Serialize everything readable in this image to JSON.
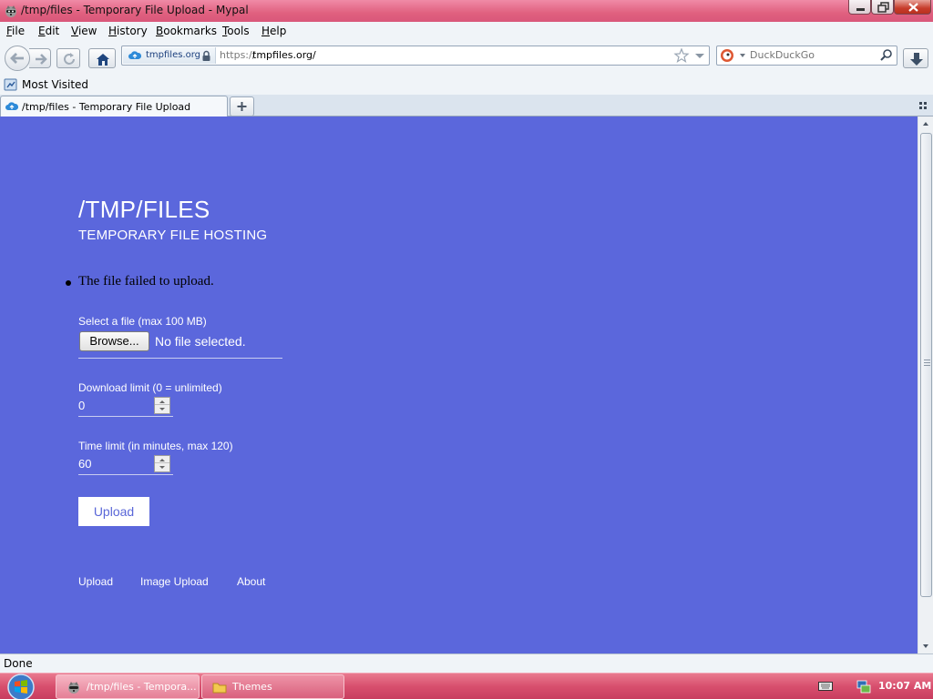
{
  "window": {
    "title": "/tmp/files - Temporary File Upload - Mypal"
  },
  "menu": {
    "items": [
      {
        "label": "File",
        "mnemonic": "F",
        "rest": "ile"
      },
      {
        "label": "Edit",
        "mnemonic": "E",
        "rest": "dit"
      },
      {
        "label": "View",
        "mnemonic": "V",
        "rest": "iew"
      },
      {
        "label": "History",
        "mnemonic": "H",
        "rest": "istory"
      },
      {
        "label": "Bookmarks",
        "mnemonic": "B",
        "rest": "ookmarks"
      },
      {
        "label": "Tools",
        "mnemonic": "T",
        "rest": "ools"
      },
      {
        "label": "Help",
        "mnemonic": "H",
        "rest": "elp"
      }
    ]
  },
  "navbar": {
    "identity_label": "tmpfiles.org",
    "url_protocol": "https://",
    "url_host": "tmpfiles.org/",
    "search_placeholder": "DuckDuckGo"
  },
  "bookmarks": {
    "most_visited": "Most Visited"
  },
  "tabs": [
    {
      "label": "/tmp/files - Temporary File Upload",
      "active": true
    }
  ],
  "page": {
    "background": "#5b67dc",
    "title": "/TMP/FILES",
    "subtitle": "TEMPORARY FILE HOSTING",
    "error_message": "The file failed to upload.",
    "file_field": {
      "label": "Select a file (max 100 MB)",
      "button_label": "Browse...",
      "status": "No file selected."
    },
    "download_limit": {
      "label": "Download limit (0 = unlimited)",
      "value": "0"
    },
    "time_limit": {
      "label": "Time limit (in minutes, max 120)",
      "value": "60"
    },
    "upload_button": "Upload",
    "footer_links": [
      "Upload",
      "Image Upload",
      "About"
    ]
  },
  "status_bar": {
    "text": "Done"
  },
  "taskbar": {
    "items": [
      {
        "label": "/tmp/files - Tempora...",
        "active": true,
        "icon": "browser-raccoon-icon"
      },
      {
        "label": "Themes",
        "active": false,
        "icon": "folder-icon"
      }
    ],
    "clock": "10:07 AM"
  }
}
